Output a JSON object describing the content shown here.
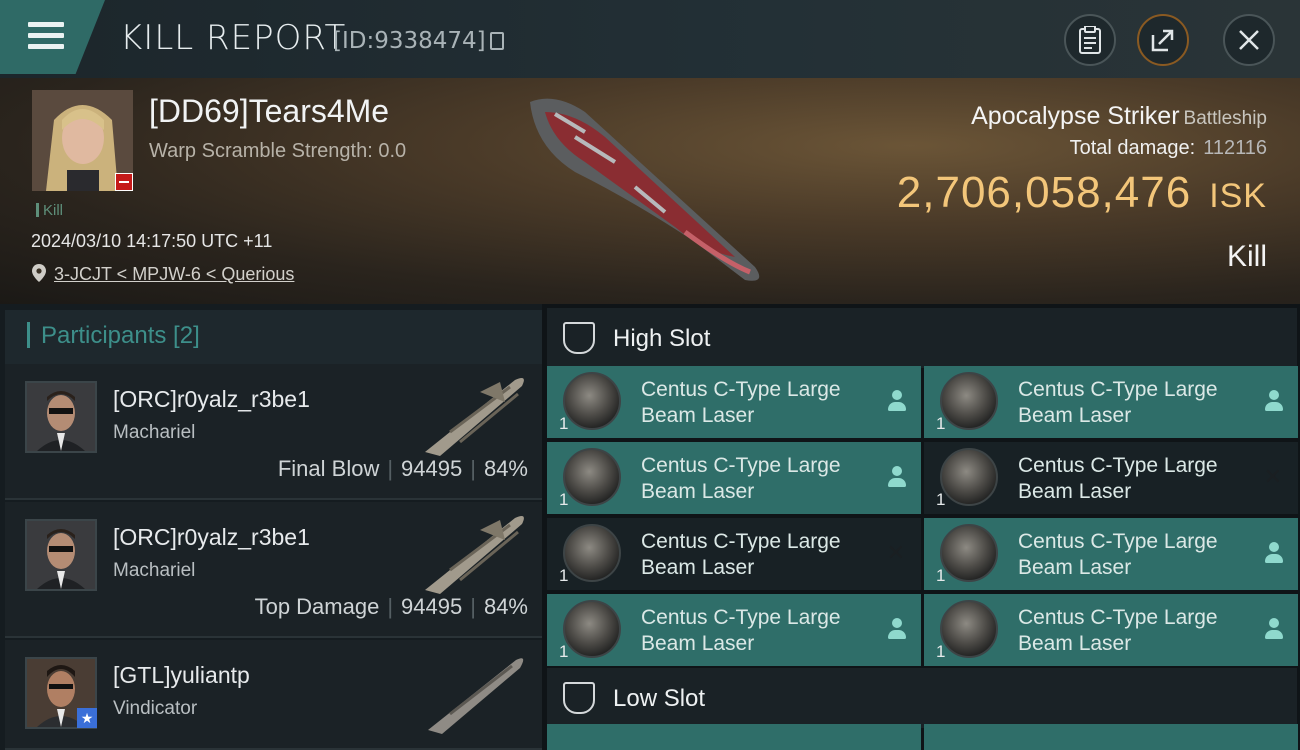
{
  "header": {
    "title": "KILL REPORT",
    "report_id": "[ID:9338474]",
    "buttons": [
      "clipboard-icon",
      "share-icon",
      "close-icon"
    ]
  },
  "victim": {
    "name": "[DD69]Tears4Me",
    "warp_scramble": "Warp Scramble Strength: 0.0",
    "tag": "Kill",
    "datetime": "2024/03/10 14:17:50 UTC +11",
    "location": "3-JCJT < MPJW-6 < Querious",
    "ship_name": "Apocalypse Striker",
    "ship_class": "Battleship",
    "total_damage_label": "Total damage:",
    "total_damage": "112116",
    "isk_value": "2,706,058,476",
    "isk_unit": "ISK",
    "result": "Kill"
  },
  "participants": {
    "title": "Participants [2]",
    "rows": [
      {
        "name": "[ORC]r0yalz_r3be1",
        "ship": "Machariel",
        "role": "Final Blow",
        "damage": "94495",
        "percent": "84%"
      },
      {
        "name": "[ORC]r0yalz_r3be1",
        "ship": "Machariel",
        "role": "Top Damage",
        "damage": "94495",
        "percent": "84%"
      },
      {
        "name": "[GTL]yuliantp",
        "ship": "Vindicator"
      }
    ]
  },
  "slots": {
    "high": {
      "label": "High Slot",
      "items": [
        {
          "qty": "1",
          "name": "Centus C-Type Large Beam Laser",
          "state": "dropped"
        },
        {
          "qty": "1",
          "name": "Centus C-Type Large Beam Laser",
          "state": "dropped"
        },
        {
          "qty": "1",
          "name": "Centus C-Type Large Beam Laser",
          "state": "dropped"
        },
        {
          "qty": "1",
          "name": "Centus C-Type Large Beam Laser",
          "state": "destroyed"
        },
        {
          "qty": "1",
          "name": "Centus C-Type Large Beam Laser",
          "state": "destroyed"
        },
        {
          "qty": "1",
          "name": "Centus C-Type Large Beam Laser",
          "state": "dropped"
        },
        {
          "qty": "1",
          "name": "Centus C-Type Large Beam Laser",
          "state": "dropped"
        },
        {
          "qty": "1",
          "name": "Centus C-Type Large Beam Laser",
          "state": "dropped"
        }
      ]
    },
    "low": {
      "label": "Low Slot"
    }
  },
  "colors": {
    "accent": "#2f6e69",
    "isk": "#f3c67a",
    "teal_text": "#3d8f8a"
  }
}
